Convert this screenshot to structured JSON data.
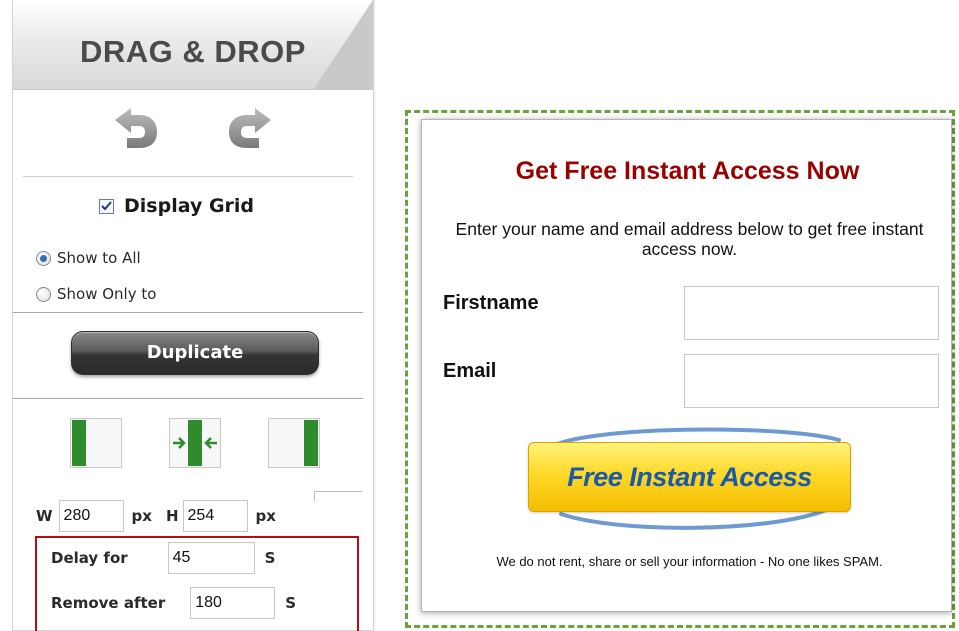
{
  "panel": {
    "title": "DRAG & DROP",
    "display_grid": {
      "label": "Display Grid",
      "checked": true
    },
    "visibility": {
      "options": [
        "Show to All",
        "Show Only to"
      ],
      "selected": "Show to All"
    },
    "duplicate_label": "Duplicate",
    "size": {
      "w_label": "W",
      "width": "280",
      "w_unit": "px",
      "h_label": "H",
      "height": "254",
      "h_unit": "px"
    },
    "timing": {
      "delay_label": "Delay for",
      "delay_value": "45",
      "delay_unit": "S",
      "remove_label": "Remove after",
      "remove_value": "180",
      "remove_unit": "S"
    },
    "icons": [
      "undo-icon",
      "redo-icon",
      "align-left-icon",
      "align-center-icon",
      "align-right-icon",
      "checkbox-check-icon"
    ]
  },
  "form": {
    "title": "Get Free Instant Access Now",
    "description": "Enter your name and email address below to get free instant access now.",
    "firstname_label": "Firstname",
    "firstname_value": "",
    "email_label": "Email",
    "email_value": "",
    "submit_label": "Free Instant Access",
    "privacy_note": "We do not rent, share or sell your information - No one likes SPAM."
  },
  "colors": {
    "form_title": "#990000",
    "submit_text": "#1a5aa8",
    "submit_fill": "#ffd92a",
    "dashed_border": "#6aa33a",
    "highlight_border": "#b40f17",
    "align_green": "#2e8b2e"
  }
}
